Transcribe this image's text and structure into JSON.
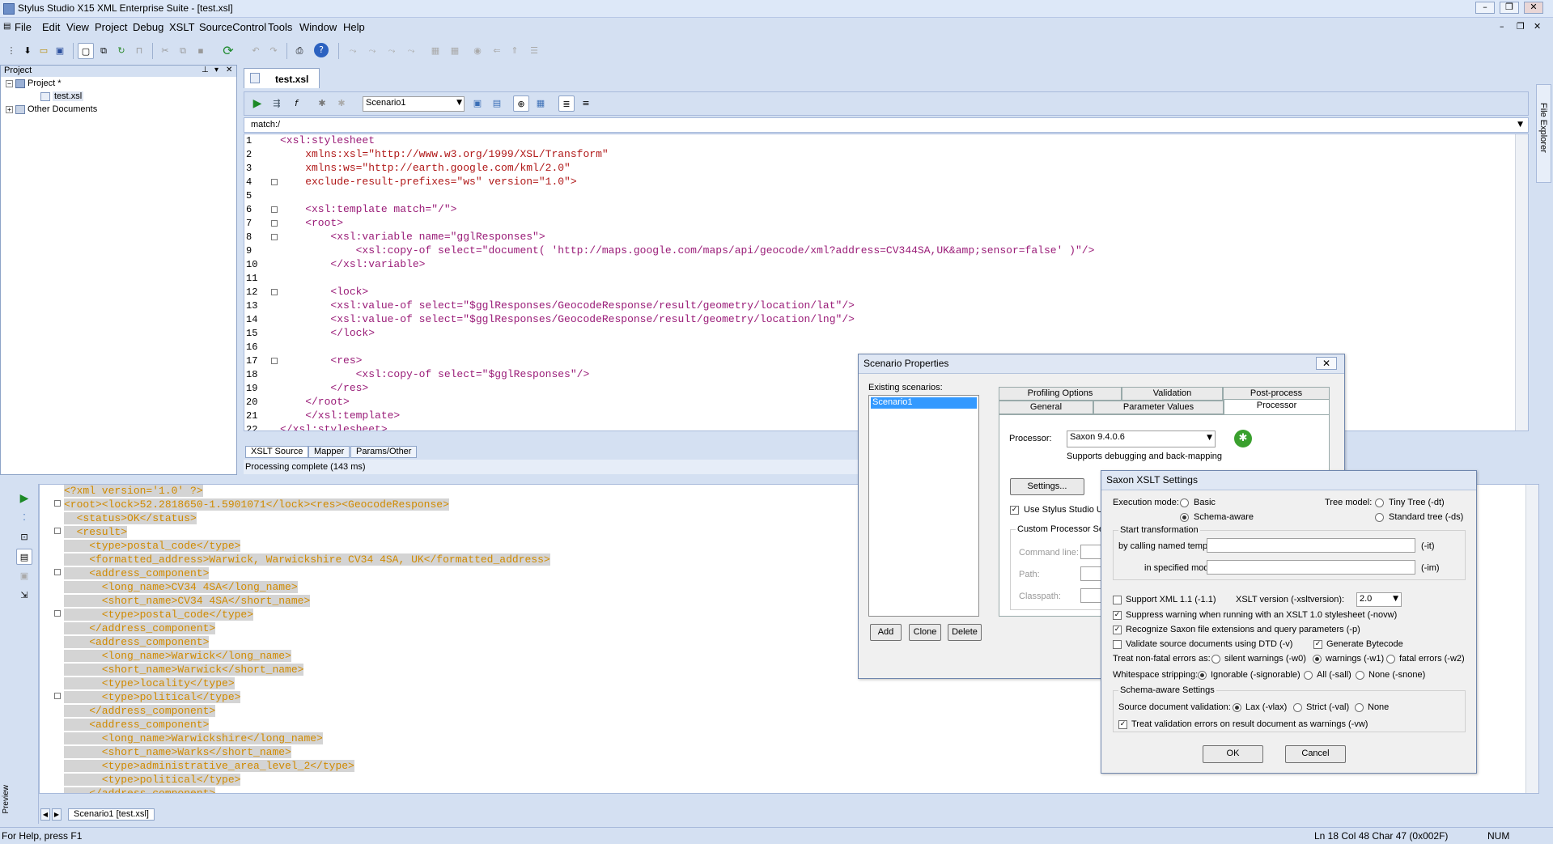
{
  "window": {
    "title": "Stylus Studio X15 XML Enterprise Suite - [test.xsl]"
  },
  "menu": [
    "File",
    "Edit",
    "View",
    "Project",
    "Debug",
    "XSLT",
    "SourceControl",
    "Tools",
    "Window",
    "Help"
  ],
  "project": {
    "panel_title": "Project",
    "root": "Project *",
    "file": "test.xsl",
    "other": "Other Documents"
  },
  "doc_tab": "test.xsl",
  "xslt_toolbar": {
    "scenario_select": "Scenario1"
  },
  "match_bar": "match:/",
  "side_tab": "File Explorer",
  "editor": {
    "line_numbers": [
      "1",
      "2",
      "3",
      "4",
      "5",
      "6",
      "7",
      "8",
      "9",
      "10",
      "11",
      "12",
      "13",
      "14",
      "15",
      "16",
      "17",
      "18",
      "19",
      "20",
      "21",
      "22"
    ],
    "lines": [
      "<xsl:stylesheet",
      "    xmlns:xsl=\"http://www.w3.org/1999/XSL/Transform\"",
      "    xmlns:ws=\"http://earth.google.com/kml/2.0\"",
      "    exclude-result-prefixes=\"ws\" version=\"1.0\">",
      "",
      "    <xsl:template match=\"/\">",
      "    <root>",
      "        <xsl:variable name=\"gglResponses\">",
      "            <xsl:copy-of select=\"document( 'http://maps.google.com/maps/api/geocode/xml?address=CV344SA,UK&amp;sensor=false' )\"/>",
      "        </xsl:variable>",
      "",
      "        <lock>",
      "        <xsl:value-of select=\"$gglResponses/GeocodeResponse/result/geometry/location/lat\"/>",
      "        <xsl:value-of select=\"$gglResponses/GeocodeResponse/result/geometry/location/lng\"/>",
      "        </lock>",
      "",
      "        <res>",
      "            <xsl:copy-of select=\"$gglResponses\"/>",
      "        </res>",
      "    </root>",
      "    </xsl:template>",
      "</xsl:stylesheet>"
    ]
  },
  "editor_tabs": [
    "XSLT Source",
    "Mapper",
    "Params/Other"
  ],
  "processing_message": "Processing complete (143 ms)",
  "output": {
    "lines": [
      "<?xml version='1.0' ?>",
      "<root><lock>52.2818650-1.5901071</lock><res><GeocodeResponse>",
      "  <status>OK</status>",
      "  <result>",
      "    <type>postal_code</type>",
      "    <formatted_address>Warwick, Warwickshire CV34 4SA, UK</formatted_address>",
      "    <address_component>",
      "      <long_name>CV34 4SA</long_name>",
      "      <short_name>CV34 4SA</short_name>",
      "      <type>postal_code</type>",
      "    </address_component>",
      "    <address_component>",
      "      <long_name>Warwick</long_name>",
      "      <short_name>Warwick</short_name>",
      "      <type>locality</type>",
      "      <type>political</type>",
      "    </address_component>",
      "    <address_component>",
      "      <long_name>Warwickshire</long_name>",
      "      <short_name>Warks</short_name>",
      "      <type>administrative_area_level_2</type>",
      "      <type>political</type>",
      "    </address_component>"
    ],
    "tab": "Scenario1 [test.xsl]",
    "side_label": "Preview"
  },
  "status": {
    "help": "For Help, press F1",
    "position": "Ln 18 Col 48  Char 47 (0x002F)",
    "num": "NUM"
  },
  "scenario_dialog": {
    "title": "Scenario Properties",
    "existing_label": "Existing scenarios:",
    "scenarios": [
      "Scenario1"
    ],
    "tabs_back": [
      "Profiling Options",
      "Validation",
      "Post-process"
    ],
    "tabs_front": [
      "General",
      "Parameter Values",
      "Processor"
    ],
    "processor_label": "Processor:",
    "processor_value": "Saxon 9.4.0.6",
    "supports": "Supports debugging and back-mapping",
    "settings_button": "Settings...",
    "use_stylus": "Use Stylus Studio UR",
    "custom_group": "Custom Processor Set",
    "command_line": "Command line:",
    "path": "Path:",
    "classpath": "Classpath:",
    "add": "Add",
    "clone": "Clone",
    "delete": "Delete"
  },
  "saxon_dialog": {
    "title": "Saxon XSLT Settings",
    "exec_mode": "Execution mode:",
    "basic": "Basic",
    "schema_aware": "Schema-aware",
    "tree_model": "Tree model:",
    "tiny_tree": "Tiny Tree (-dt)",
    "standard_tree": "Standard tree (-ds)",
    "start_group": "Start transformation",
    "by_named": "by calling named template:",
    "it": "(-it)",
    "in_mode": "in specified mode:",
    "im": "(-im)",
    "support_xml11": "Support XML 1.1 (-1.1)",
    "xslt_version_label": "XSLT version (-xsltversion):",
    "xslt_version": "2.0",
    "suppress": "Suppress warning when running with an XSLT 1.0 stylesheet (-novw)",
    "recognize": "Recognize Saxon file extensions and query parameters (-p)",
    "validate_dtd": "Validate source documents using DTD (-v)",
    "gen_bytecode": "Generate Bytecode",
    "treat_nonfatal": "Treat non-fatal errors as:",
    "silent": "silent warnings (-w0)",
    "warnings": "warnings (-w1)",
    "fatal": "fatal errors (-w2)",
    "ws_strip": "Whitespace stripping:",
    "ignorable": "Ignorable (-signorable)",
    "all": "All (-sall)",
    "none_ws": "None (-snone)",
    "schema_group": "Schema-aware Settings",
    "source_validation": "Source document validation:",
    "lax": "Lax (-vlax)",
    "strict": "Strict (-val)",
    "none": "None",
    "treat_validation": "Treat validation errors on result document as warnings (-vw)",
    "ok": "OK",
    "cancel": "Cancel"
  }
}
